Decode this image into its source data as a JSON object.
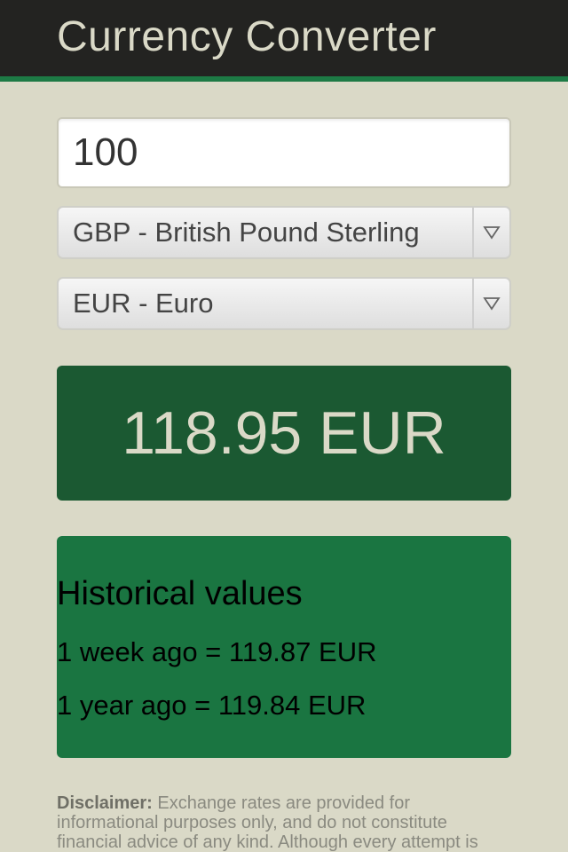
{
  "header": {
    "title": "Currency Converter"
  },
  "amount": {
    "value": "100"
  },
  "from_currency": {
    "selected": "GBP - British Pound Sterling",
    "icon": "triangle-down-icon"
  },
  "to_currency": {
    "selected": "EUR - Euro",
    "icon": "triangle-down-icon"
  },
  "result": {
    "value": "118.95 EUR"
  },
  "history": {
    "title": "Historical values",
    "week_ago": "1 week ago = 119.87 EUR",
    "year_ago": "1 year ago = 119.84 EUR"
  },
  "disclaimer": {
    "label": "Disclaimer:",
    "text": " Exchange rates are provided for informational purposes only, and do not constitute financial advice of any kind. Although every attempt is"
  },
  "colors": {
    "header_bg": "#232321",
    "accent_green": "#1d7a45",
    "result_bg": "#1b5932",
    "history_bg": "#1a7541",
    "page_bg": "#dad9c7"
  }
}
